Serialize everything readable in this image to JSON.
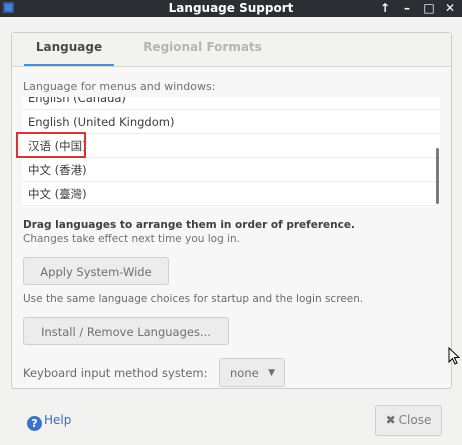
{
  "window": {
    "title": "Language Support",
    "controls": {
      "up": "↑",
      "minimize": "–",
      "maximize": "□",
      "close": "✕"
    }
  },
  "tabs": [
    {
      "label": "Language",
      "active": true
    },
    {
      "label": "Regional Formats",
      "active": false
    }
  ],
  "language_tab": {
    "menus_label": "Language for menus and windows:",
    "languages": [
      "English (Canada)",
      "English (United Kingdom)",
      "汉语 (中国)",
      "中文 (香港)",
      "中文 (臺灣)"
    ],
    "selected_index": 2,
    "drag_title": "Drag languages to arrange them in order of preference.",
    "drag_subtitle": "Changes take effect next time you log in.",
    "apply_button": "Apply System-Wide",
    "apply_note": "Use the same language choices for startup and the login screen.",
    "install_button": "Install / Remove Languages...",
    "keyboard_label": "Keyboard input method system:",
    "keyboard_value": "none"
  },
  "footer": {
    "help_label": "Help",
    "close_label": "Close"
  },
  "colors": {
    "titlebar": "#2b2e33",
    "tab_accent": "#4a90d9",
    "highlight_box": "#d9333a",
    "help_link": "#3b6bb3"
  }
}
